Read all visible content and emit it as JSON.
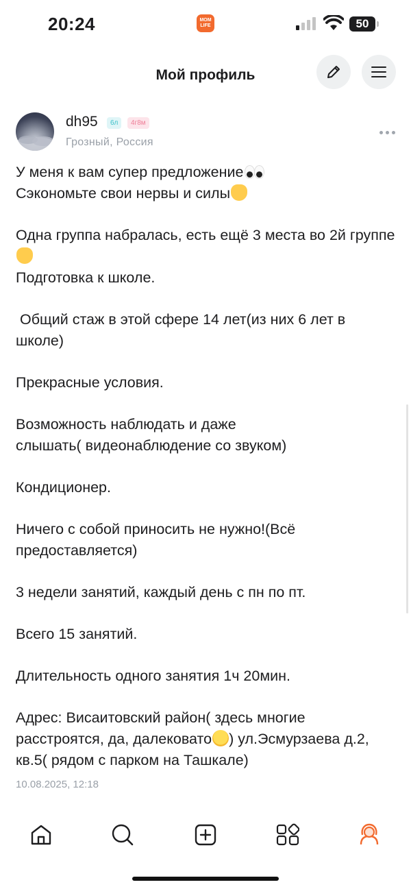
{
  "status_bar": {
    "time": "20:24",
    "app_badge": [
      "MOM",
      "LIFE"
    ],
    "battery": "50"
  },
  "header": {
    "title": "Мой профиль",
    "edit_icon": "pencil-icon",
    "menu_icon": "hamburger-icon"
  },
  "author": {
    "username": "dh95",
    "badge_age": "6л",
    "badge_child": "4г8м",
    "location": "Грозный, Россия"
  },
  "post": {
    "paragraphs": [
      [
        "У меня к вам супер предложение",
        "Сэкономьте свои нервы и силы"
      ],
      [
        "Одна группа набралась, есть ещё 3 места во 2й группе",
        "Подготовка к школе."
      ],
      [
        " Общий стаж в этой сфере 14 лет(из них 6 лет в школе)"
      ],
      [
        "Прекрасные условия."
      ],
      [
        "Возможность наблюдать и даже",
        "слышать( видеонаблюдение со звуком)"
      ],
      [
        "Кондиционер."
      ],
      [
        "Ничего с собой приносить не нужно!(Всё предоставляется)"
      ],
      [
        "3 недели занятий, каждый день с пн по пт."
      ],
      [
        "Всего 15 занятий."
      ],
      [
        "Длительность одного занятия 1ч 20мин."
      ],
      [
        "Адрес: Висаитовский район( здесь многие расстроятся, да, далековато",
        ") ул.Эсмурзаева д.2, кв.5( рядом с парком на Ташкале)"
      ]
    ],
    "date": "10.08.2025, 12:18"
  },
  "bottom_nav": {
    "items": [
      "home-icon",
      "search-icon",
      "add-post-icon",
      "services-icon",
      "profile-icon"
    ],
    "active": "profile-icon"
  },
  "colors": {
    "accent": "#f26a2e",
    "muted_text": "#9aa0a8",
    "badge_age_bg": "#dff5f7",
    "badge_child_bg": "#fde4ea"
  }
}
